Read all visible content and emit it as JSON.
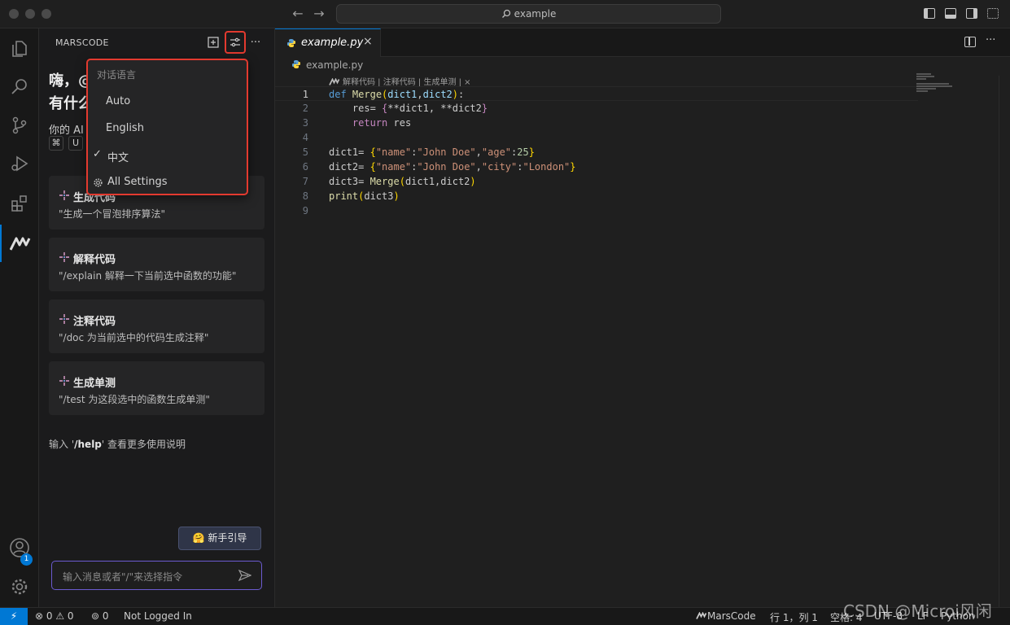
{
  "window": {
    "search_text": "example"
  },
  "sidebar": {
    "title": "MARSCODE",
    "more": "···",
    "greeting_line1": "嗨，@",
    "greeting_line2": "有什么",
    "ai_intro": "你的 AI",
    "keys": [
      "⌘",
      "U"
    ],
    "cards": [
      {
        "title": "生成代码",
        "desc": "\"生成一个冒泡排序算法\""
      },
      {
        "title": "解释代码",
        "desc": "\"/explain 解释一下当前选中函数的功能\""
      },
      {
        "title": "注释代码",
        "desc": "\"/doc 为当前选中的代码生成注释\""
      },
      {
        "title": "生成单测",
        "desc": "\"/test 为这段选中的函数生成单测\""
      }
    ],
    "help_prefix": "输入 '",
    "help_cmd": "/help",
    "help_suffix": "' 查看更多使用说明",
    "guide_button": "🤗 新手引导",
    "input_placeholder": "输入消息或者\"/\"来选择指令"
  },
  "dropdown": {
    "header": "对话语言",
    "items": [
      {
        "label": "Auto",
        "checked": false
      },
      {
        "label": "English",
        "checked": false
      },
      {
        "label": "中文",
        "checked": true
      }
    ],
    "settings_label": "All Settings",
    "check_glyph": "✓"
  },
  "editor": {
    "tab_name": "example.py",
    "tab_close": "×",
    "breadcrumb": "example.py",
    "codelens": "解释代码 | 注释代码 | 生成单测 | ×",
    "line_numbers": [
      "1",
      "2",
      "3",
      "4",
      "5",
      "6",
      "7",
      "8",
      "9"
    ]
  },
  "activity": {
    "account_badge": "1"
  },
  "statusbar": {
    "remote": "⚡",
    "problems": "⊗ 0 ⚠ 0",
    "ports": "0",
    "login": "Not Logged In",
    "brand": "MarsCode",
    "cursor": "行 1，列 1",
    "spaces": "空格: 4",
    "encoding": "UTF-8",
    "eol": "LF",
    "language": "Python"
  },
  "watermark": "CSDN @Microi风闲",
  "colors": {
    "accent": "#0078d4",
    "highlight_border": "#e33a2f",
    "input_border": "#6b5bd0"
  }
}
